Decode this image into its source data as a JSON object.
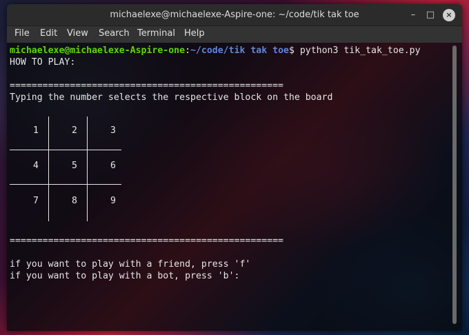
{
  "window": {
    "title": "michaelexe@michaelexe-Aspire-one: ~/code/tik tak toe",
    "buttons": {
      "minimize": "–",
      "maximize": "□",
      "close": "×"
    }
  },
  "menu": [
    "File",
    "Edit",
    "View",
    "Search",
    "Terminal",
    "Help"
  ],
  "prompt": {
    "user_host": "michaelexe@michaelexe-Aspire-one",
    "colon": ":",
    "path": "~/code/tik tak toe",
    "dollar": "$ ",
    "command": "python3 tik_tak_toe.py"
  },
  "output": {
    "how_to_play": "HOW TO PLAY:",
    "separator": "==================================================",
    "instructions": "Typing the number selects the respective block on the board",
    "board_cells": [
      "1",
      "2",
      "3",
      "4",
      "5",
      "6",
      "7",
      "8",
      "9"
    ],
    "separator2": "==================================================",
    "friend_line": "if you want to play with a friend, press 'f'",
    "bot_line": "if you want to play with a bot, press 'b':"
  }
}
